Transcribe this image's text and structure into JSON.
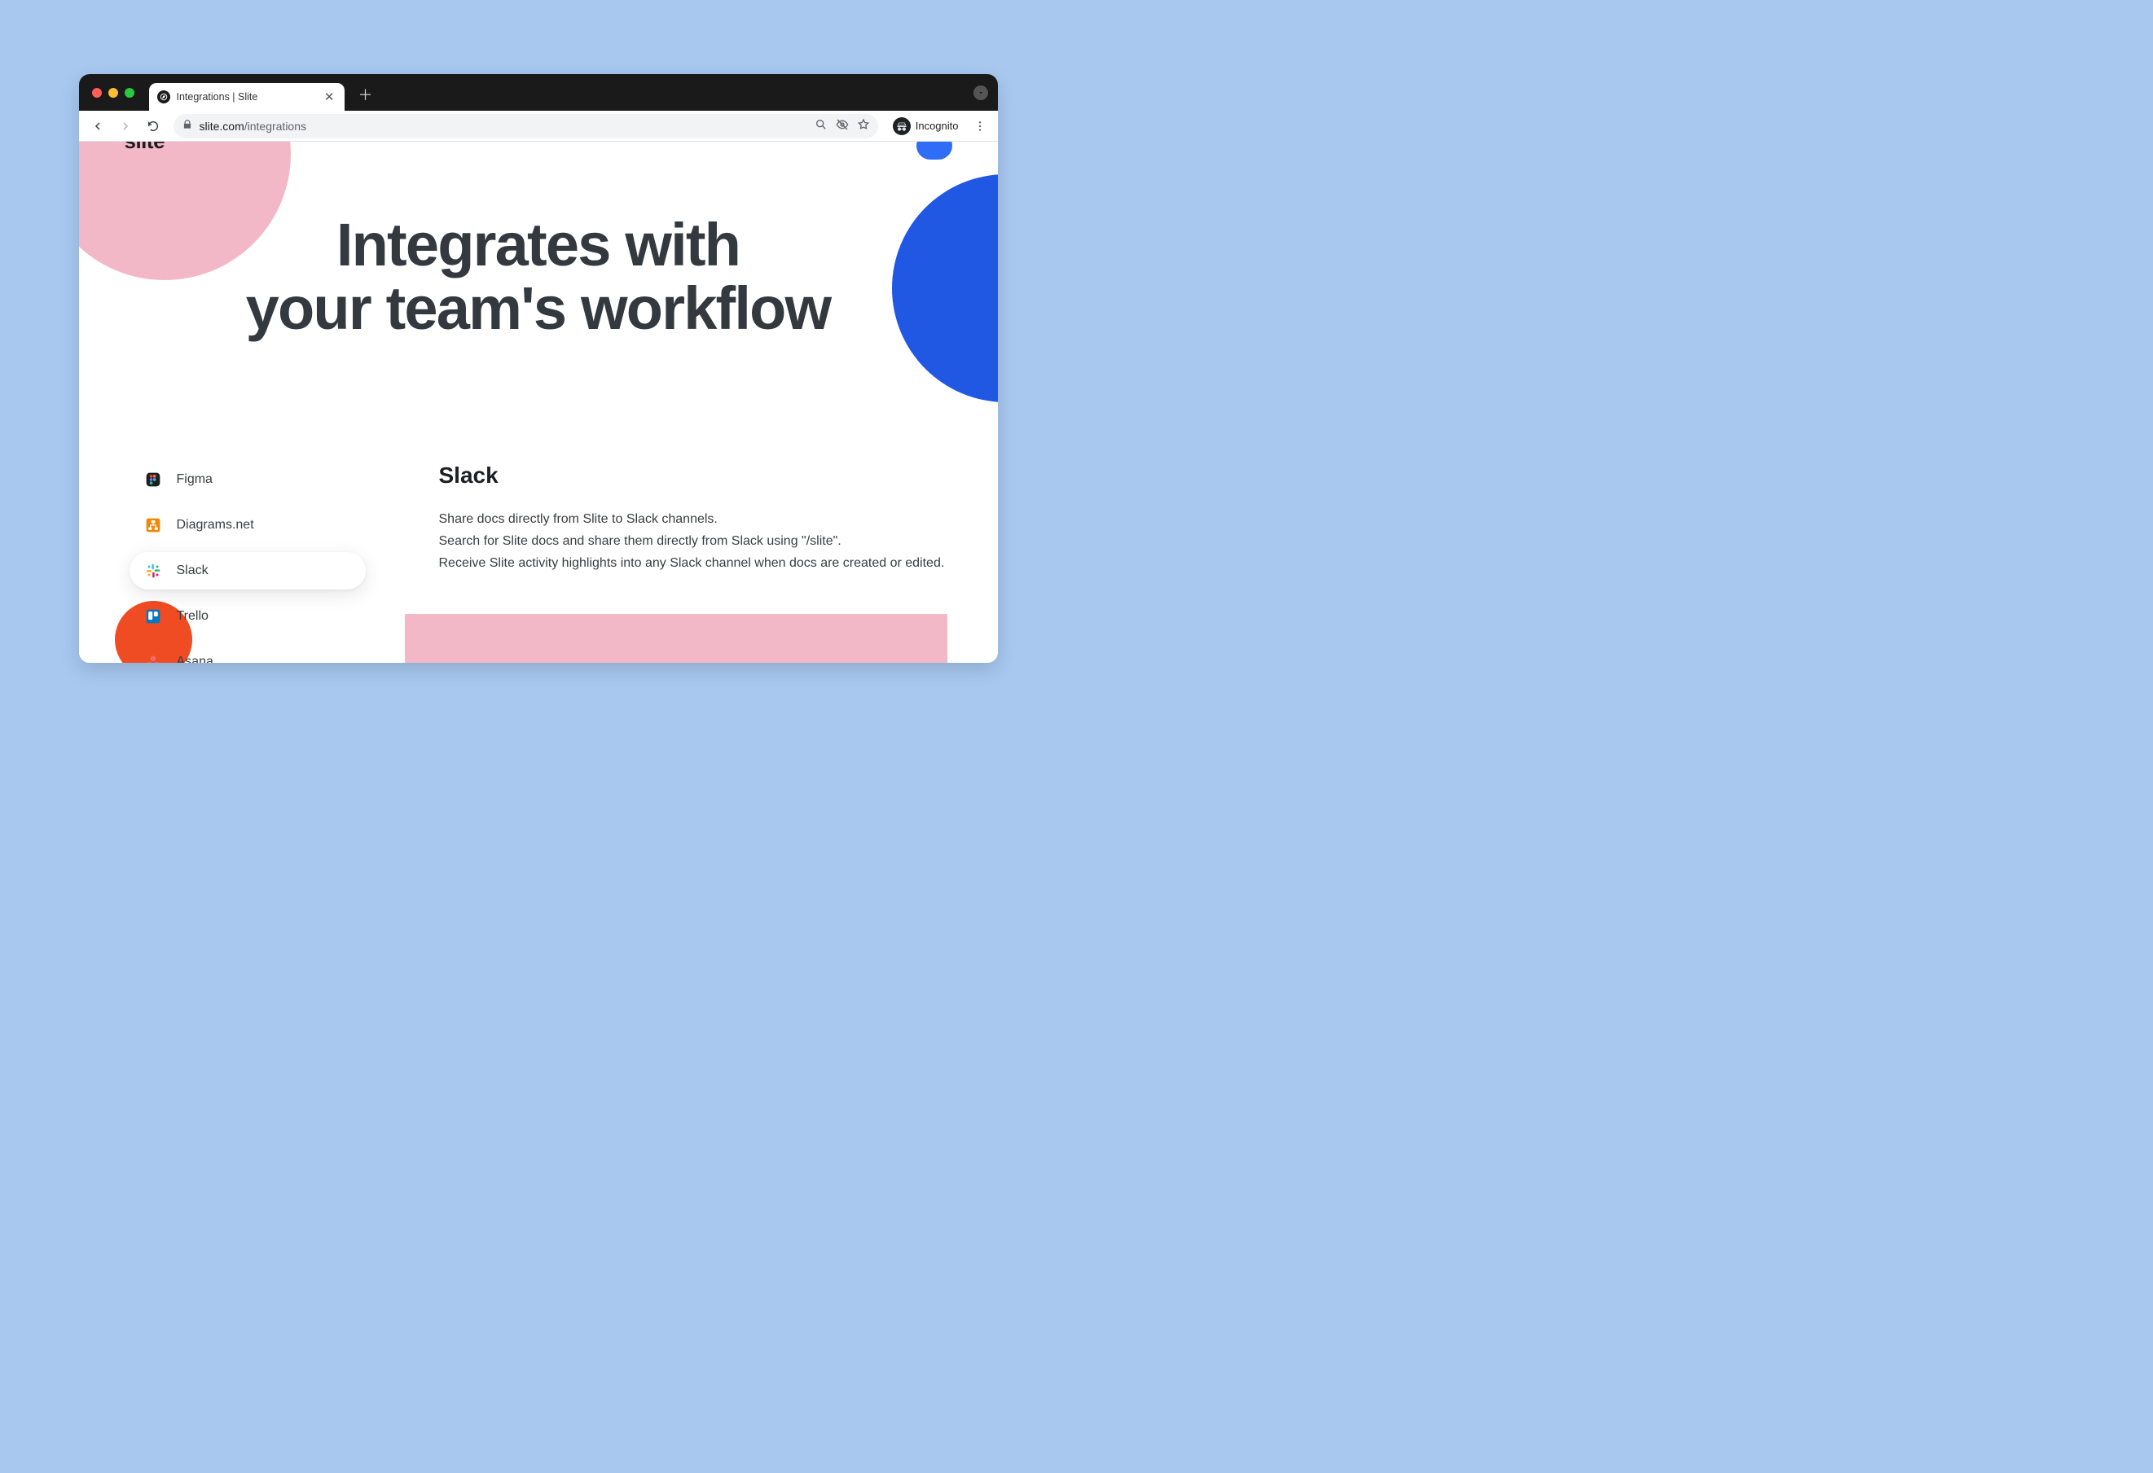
{
  "browser": {
    "tab_title": "Integrations | Slite",
    "url_host": "slite.com",
    "url_path": "/integrations",
    "incognito_label": "Incognito"
  },
  "page": {
    "brand": "slite",
    "cta": "",
    "hero_line1": "Integrates with",
    "hero_line2": "your team's workflow"
  },
  "integrations": {
    "items": [
      {
        "label": "Figma"
      },
      {
        "label": "Diagrams.net"
      },
      {
        "label": "Slack"
      },
      {
        "label": "Trello"
      },
      {
        "label": "Asana"
      }
    ],
    "active_index": 2,
    "detail": {
      "title": "Slack",
      "line1": "Share docs directly from Slite to Slack channels.",
      "line2": "Search for Slite docs and share them directly from Slack using \"/slite\".",
      "line3": "Receive Slite activity highlights into any Slack channel when docs are created or edited."
    }
  }
}
